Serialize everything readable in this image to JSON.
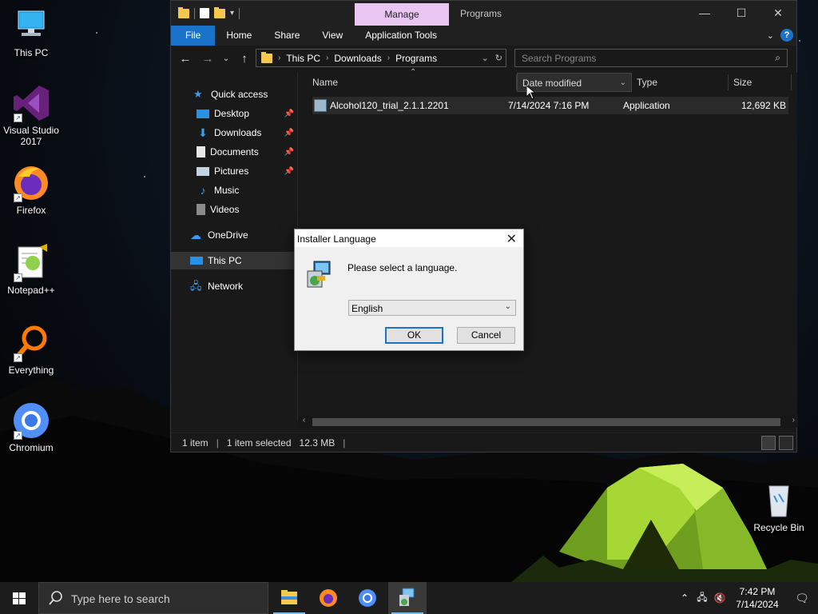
{
  "desktop": {
    "icons": [
      {
        "label": "This PC"
      },
      {
        "label": "Visual Studio 2017"
      },
      {
        "label": "Firefox"
      },
      {
        "label": "Notepad++"
      },
      {
        "label": "Everything"
      },
      {
        "label": "Chromium"
      },
      {
        "label": "Recycle Bin"
      }
    ]
  },
  "explorer": {
    "manage_tab": "Manage",
    "title": "Programs",
    "ribbon_tabs": [
      "File",
      "Home",
      "Share",
      "View",
      "Application Tools"
    ],
    "breadcrumb": [
      "This PC",
      "Downloads",
      "Programs"
    ],
    "search_placeholder": "Search Programs",
    "nav": {
      "quick_access": "Quick access",
      "items": [
        "Desktop",
        "Downloads",
        "Documents",
        "Pictures",
        "Music",
        "Videos"
      ],
      "onedrive": "OneDrive",
      "this_pc": "This PC",
      "network": "Network"
    },
    "columns": {
      "name": "Name",
      "date": "Date modified",
      "type": "Type",
      "size": "Size"
    },
    "files": [
      {
        "name": "Alcohol120_trial_2.1.1.2201",
        "date": "7/14/2024 7:16 PM",
        "type": "Application",
        "size": "12,692 KB"
      }
    ],
    "status": {
      "count": "1 item",
      "selected": "1 item selected",
      "size": "12.3 MB"
    }
  },
  "dialog": {
    "title": "Installer Language",
    "message": "Please select a language.",
    "selected_language": "English",
    "ok": "OK",
    "cancel": "Cancel"
  },
  "taskbar": {
    "search_placeholder": "Type here to search",
    "time": "7:42 PM",
    "date": "7/14/2024"
  },
  "colors": {
    "accent": "#1a73c8",
    "manage_tab": "#e8c6f1",
    "explorer_bg": "#191919"
  }
}
